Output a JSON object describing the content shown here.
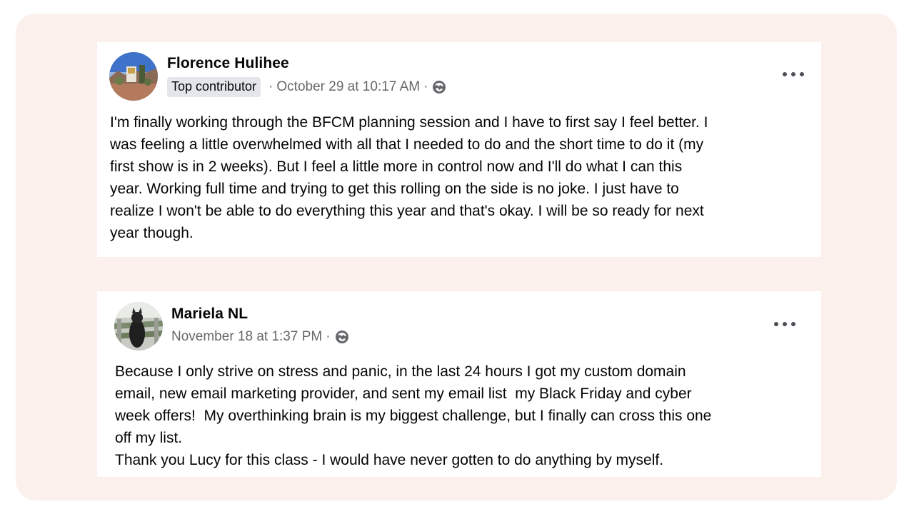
{
  "posts": [
    {
      "author": "Florence Hulihee",
      "badge": "Top contributor",
      "separator": "·",
      "timestamp": "October 29 at 10:17 AM",
      "audience_icon": "globe-icon",
      "menu_icon": "more-options-icon",
      "text": "I'm finally working through the BFCM planning session and I have to first say I feel better. I\nwas feeling a little overwhelmed with all that I needed to do and the short time to do it (my\nfirst show is in 2 weeks). But I feel a little more in control now and I'll do what I can this\nyear. Working full time and trying to get this rolling on the side is no joke. I just have to\nrealize I won't be able to do everything this year and that's okay. I will be so ready for next\nyear though."
    },
    {
      "author": "Mariela NL",
      "separator": "·",
      "timestamp": "November 18 at 1:37 PM",
      "audience_icon": "globe-icon",
      "menu_icon": "more-options-icon",
      "text": "Because I only strive on stress and panic, in the last 24 hours I got my custom domain\nemail, new email marketing provider, and sent my email list  my Black Friday and cyber\nweek offers!  My overthinking brain is my biggest challenge, but I finally can cross this one\noff my list.\nThank you Lucy for this class - I would have never gotten to do anything by myself."
    }
  ],
  "colors": {
    "frame_background": "#fcf0ed",
    "card_background": "#ffffff",
    "primary_text": "#050505",
    "secondary_text": "#65676b",
    "badge_background": "#e4e6eb"
  }
}
